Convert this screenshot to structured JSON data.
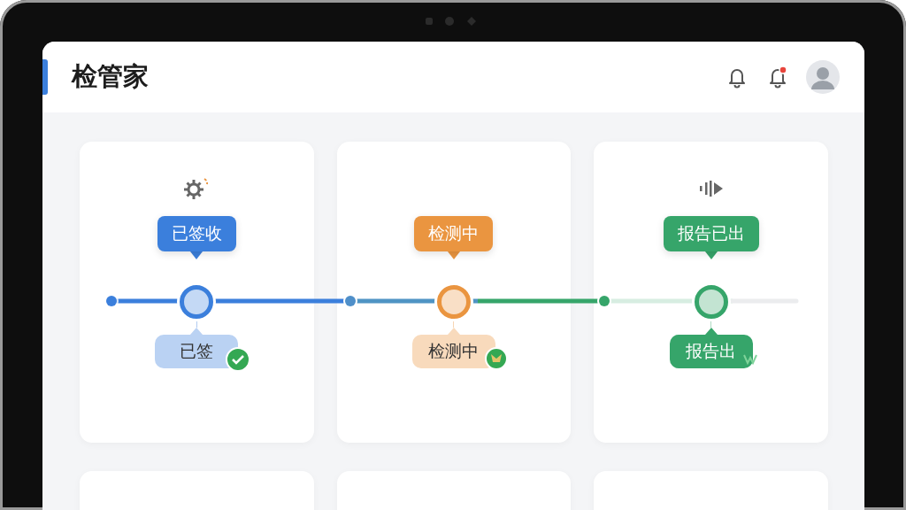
{
  "header": {
    "title": "检管家",
    "bells": [
      {
        "unread": false
      },
      {
        "unread": true
      }
    ]
  },
  "stages": [
    {
      "label": "已签收",
      "sub_label": "已签",
      "color": "#3b7fdc",
      "kind": "received"
    },
    {
      "label": "检测中",
      "sub_label": "检测中",
      "color": "#ea9540",
      "kind": "testing"
    },
    {
      "label": "报告已出",
      "sub_label": "报告出",
      "color": "#36a56a",
      "kind": "reported"
    }
  ]
}
